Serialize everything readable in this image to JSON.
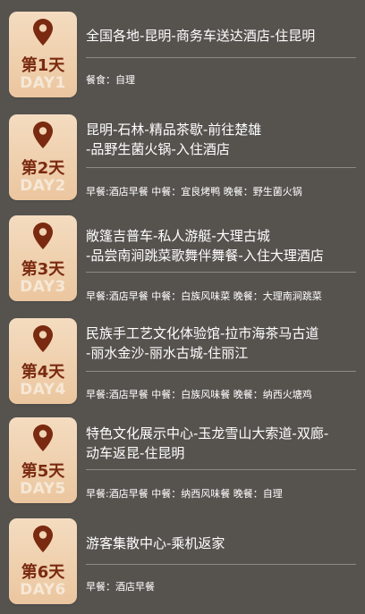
{
  "days": [
    {
      "title": "第1天",
      "day": "DAY1",
      "route_lines": [
        "全国各地-昆明-商务车送达酒店-住昆明"
      ],
      "meals": "餐食：自理"
    },
    {
      "title": "第2天",
      "day": "DAY2",
      "route_lines": [
        "昆明-石林-精品茶歇-前往楚雄",
        "-品野生菌火锅-入住酒店"
      ],
      "meals": "早餐:酒店早餐  中餐：宜良烤鸭  晚餐：野生菌火锅"
    },
    {
      "title": "第3天",
      "day": "DAY3",
      "route_lines": [
        "敞篷吉普车-私人游艇-大理古城",
        "-品尝南涧跳菜歌舞伴舞餐-入住大理酒店"
      ],
      "meals": "早餐:酒店早餐  中餐：白族风味菜  晚餐：大理南涧跳菜"
    },
    {
      "title": "第4天",
      "day": "DAY4",
      "route_lines": [
        "民族手工艺文化体验馆-拉市海茶马古道",
        "-丽水金沙-丽水古城-住丽江"
      ],
      "meals": "早餐:酒店早餐  中餐：白族风味餐  晚餐：纳西火塘鸡"
    },
    {
      "title": "第5天",
      "day": "DAY5",
      "route_lines": [
        "特色文化展示中心-玉龙雪山大索道-双廊-",
        "动车返昆-住昆明"
      ],
      "meals": "早餐:酒店早餐  中餐：纳西风味餐  晚餐：自理"
    },
    {
      "title": "第6天",
      "day": "DAY6",
      "route_lines": [
        "游客集散中心-乘机返家"
      ],
      "meals": "早餐：酒店早餐"
    }
  ],
  "colors": {
    "background": "#56534f",
    "badge_top": "#f4dcc0",
    "badge_bottom": "#ebc69f",
    "pin": "#7a2a10",
    "badge_title": "#7a2a10",
    "badge_day": "#f6e8d6"
  },
  "icons": {
    "pin": "location-pin-icon"
  }
}
